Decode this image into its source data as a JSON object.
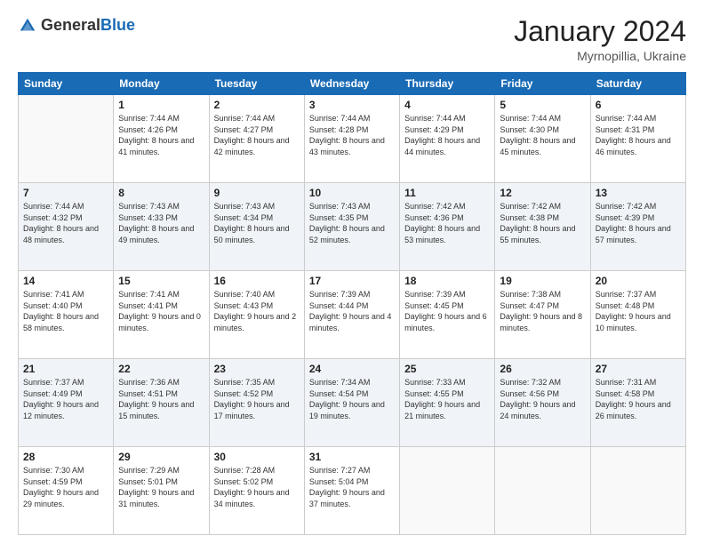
{
  "header": {
    "logo": {
      "general": "General",
      "blue": "Blue"
    },
    "title": "January 2024",
    "subtitle": "Myrnopillia, Ukraine"
  },
  "weekdays": [
    "Sunday",
    "Monday",
    "Tuesday",
    "Wednesday",
    "Thursday",
    "Friday",
    "Saturday"
  ],
  "weeks": [
    [
      {
        "day": "",
        "sunrise": "",
        "sunset": "",
        "daylight": ""
      },
      {
        "day": "1",
        "sunrise": "Sunrise: 7:44 AM",
        "sunset": "Sunset: 4:26 PM",
        "daylight": "Daylight: 8 hours and 41 minutes."
      },
      {
        "day": "2",
        "sunrise": "Sunrise: 7:44 AM",
        "sunset": "Sunset: 4:27 PM",
        "daylight": "Daylight: 8 hours and 42 minutes."
      },
      {
        "day": "3",
        "sunrise": "Sunrise: 7:44 AM",
        "sunset": "Sunset: 4:28 PM",
        "daylight": "Daylight: 8 hours and 43 minutes."
      },
      {
        "day": "4",
        "sunrise": "Sunrise: 7:44 AM",
        "sunset": "Sunset: 4:29 PM",
        "daylight": "Daylight: 8 hours and 44 minutes."
      },
      {
        "day": "5",
        "sunrise": "Sunrise: 7:44 AM",
        "sunset": "Sunset: 4:30 PM",
        "daylight": "Daylight: 8 hours and 45 minutes."
      },
      {
        "day": "6",
        "sunrise": "Sunrise: 7:44 AM",
        "sunset": "Sunset: 4:31 PM",
        "daylight": "Daylight: 8 hours and 46 minutes."
      }
    ],
    [
      {
        "day": "7",
        "sunrise": "Sunrise: 7:44 AM",
        "sunset": "Sunset: 4:32 PM",
        "daylight": "Daylight: 8 hours and 48 minutes."
      },
      {
        "day": "8",
        "sunrise": "Sunrise: 7:43 AM",
        "sunset": "Sunset: 4:33 PM",
        "daylight": "Daylight: 8 hours and 49 minutes."
      },
      {
        "day": "9",
        "sunrise": "Sunrise: 7:43 AM",
        "sunset": "Sunset: 4:34 PM",
        "daylight": "Daylight: 8 hours and 50 minutes."
      },
      {
        "day": "10",
        "sunrise": "Sunrise: 7:43 AM",
        "sunset": "Sunset: 4:35 PM",
        "daylight": "Daylight: 8 hours and 52 minutes."
      },
      {
        "day": "11",
        "sunrise": "Sunrise: 7:42 AM",
        "sunset": "Sunset: 4:36 PM",
        "daylight": "Daylight: 8 hours and 53 minutes."
      },
      {
        "day": "12",
        "sunrise": "Sunrise: 7:42 AM",
        "sunset": "Sunset: 4:38 PM",
        "daylight": "Daylight: 8 hours and 55 minutes."
      },
      {
        "day": "13",
        "sunrise": "Sunrise: 7:42 AM",
        "sunset": "Sunset: 4:39 PM",
        "daylight": "Daylight: 8 hours and 57 minutes."
      }
    ],
    [
      {
        "day": "14",
        "sunrise": "Sunrise: 7:41 AM",
        "sunset": "Sunset: 4:40 PM",
        "daylight": "Daylight: 8 hours and 58 minutes."
      },
      {
        "day": "15",
        "sunrise": "Sunrise: 7:41 AM",
        "sunset": "Sunset: 4:41 PM",
        "daylight": "Daylight: 9 hours and 0 minutes."
      },
      {
        "day": "16",
        "sunrise": "Sunrise: 7:40 AM",
        "sunset": "Sunset: 4:43 PM",
        "daylight": "Daylight: 9 hours and 2 minutes."
      },
      {
        "day": "17",
        "sunrise": "Sunrise: 7:39 AM",
        "sunset": "Sunset: 4:44 PM",
        "daylight": "Daylight: 9 hours and 4 minutes."
      },
      {
        "day": "18",
        "sunrise": "Sunrise: 7:39 AM",
        "sunset": "Sunset: 4:45 PM",
        "daylight": "Daylight: 9 hours and 6 minutes."
      },
      {
        "day": "19",
        "sunrise": "Sunrise: 7:38 AM",
        "sunset": "Sunset: 4:47 PM",
        "daylight": "Daylight: 9 hours and 8 minutes."
      },
      {
        "day": "20",
        "sunrise": "Sunrise: 7:37 AM",
        "sunset": "Sunset: 4:48 PM",
        "daylight": "Daylight: 9 hours and 10 minutes."
      }
    ],
    [
      {
        "day": "21",
        "sunrise": "Sunrise: 7:37 AM",
        "sunset": "Sunset: 4:49 PM",
        "daylight": "Daylight: 9 hours and 12 minutes."
      },
      {
        "day": "22",
        "sunrise": "Sunrise: 7:36 AM",
        "sunset": "Sunset: 4:51 PM",
        "daylight": "Daylight: 9 hours and 15 minutes."
      },
      {
        "day": "23",
        "sunrise": "Sunrise: 7:35 AM",
        "sunset": "Sunset: 4:52 PM",
        "daylight": "Daylight: 9 hours and 17 minutes."
      },
      {
        "day": "24",
        "sunrise": "Sunrise: 7:34 AM",
        "sunset": "Sunset: 4:54 PM",
        "daylight": "Daylight: 9 hours and 19 minutes."
      },
      {
        "day": "25",
        "sunrise": "Sunrise: 7:33 AM",
        "sunset": "Sunset: 4:55 PM",
        "daylight": "Daylight: 9 hours and 21 minutes."
      },
      {
        "day": "26",
        "sunrise": "Sunrise: 7:32 AM",
        "sunset": "Sunset: 4:56 PM",
        "daylight": "Daylight: 9 hours and 24 minutes."
      },
      {
        "day": "27",
        "sunrise": "Sunrise: 7:31 AM",
        "sunset": "Sunset: 4:58 PM",
        "daylight": "Daylight: 9 hours and 26 minutes."
      }
    ],
    [
      {
        "day": "28",
        "sunrise": "Sunrise: 7:30 AM",
        "sunset": "Sunset: 4:59 PM",
        "daylight": "Daylight: 9 hours and 29 minutes."
      },
      {
        "day": "29",
        "sunrise": "Sunrise: 7:29 AM",
        "sunset": "Sunset: 5:01 PM",
        "daylight": "Daylight: 9 hours and 31 minutes."
      },
      {
        "day": "30",
        "sunrise": "Sunrise: 7:28 AM",
        "sunset": "Sunset: 5:02 PM",
        "daylight": "Daylight: 9 hours and 34 minutes."
      },
      {
        "day": "31",
        "sunrise": "Sunrise: 7:27 AM",
        "sunset": "Sunset: 5:04 PM",
        "daylight": "Daylight: 9 hours and 37 minutes."
      },
      {
        "day": "",
        "sunrise": "",
        "sunset": "",
        "daylight": ""
      },
      {
        "day": "",
        "sunrise": "",
        "sunset": "",
        "daylight": ""
      },
      {
        "day": "",
        "sunrise": "",
        "sunset": "",
        "daylight": ""
      }
    ]
  ]
}
